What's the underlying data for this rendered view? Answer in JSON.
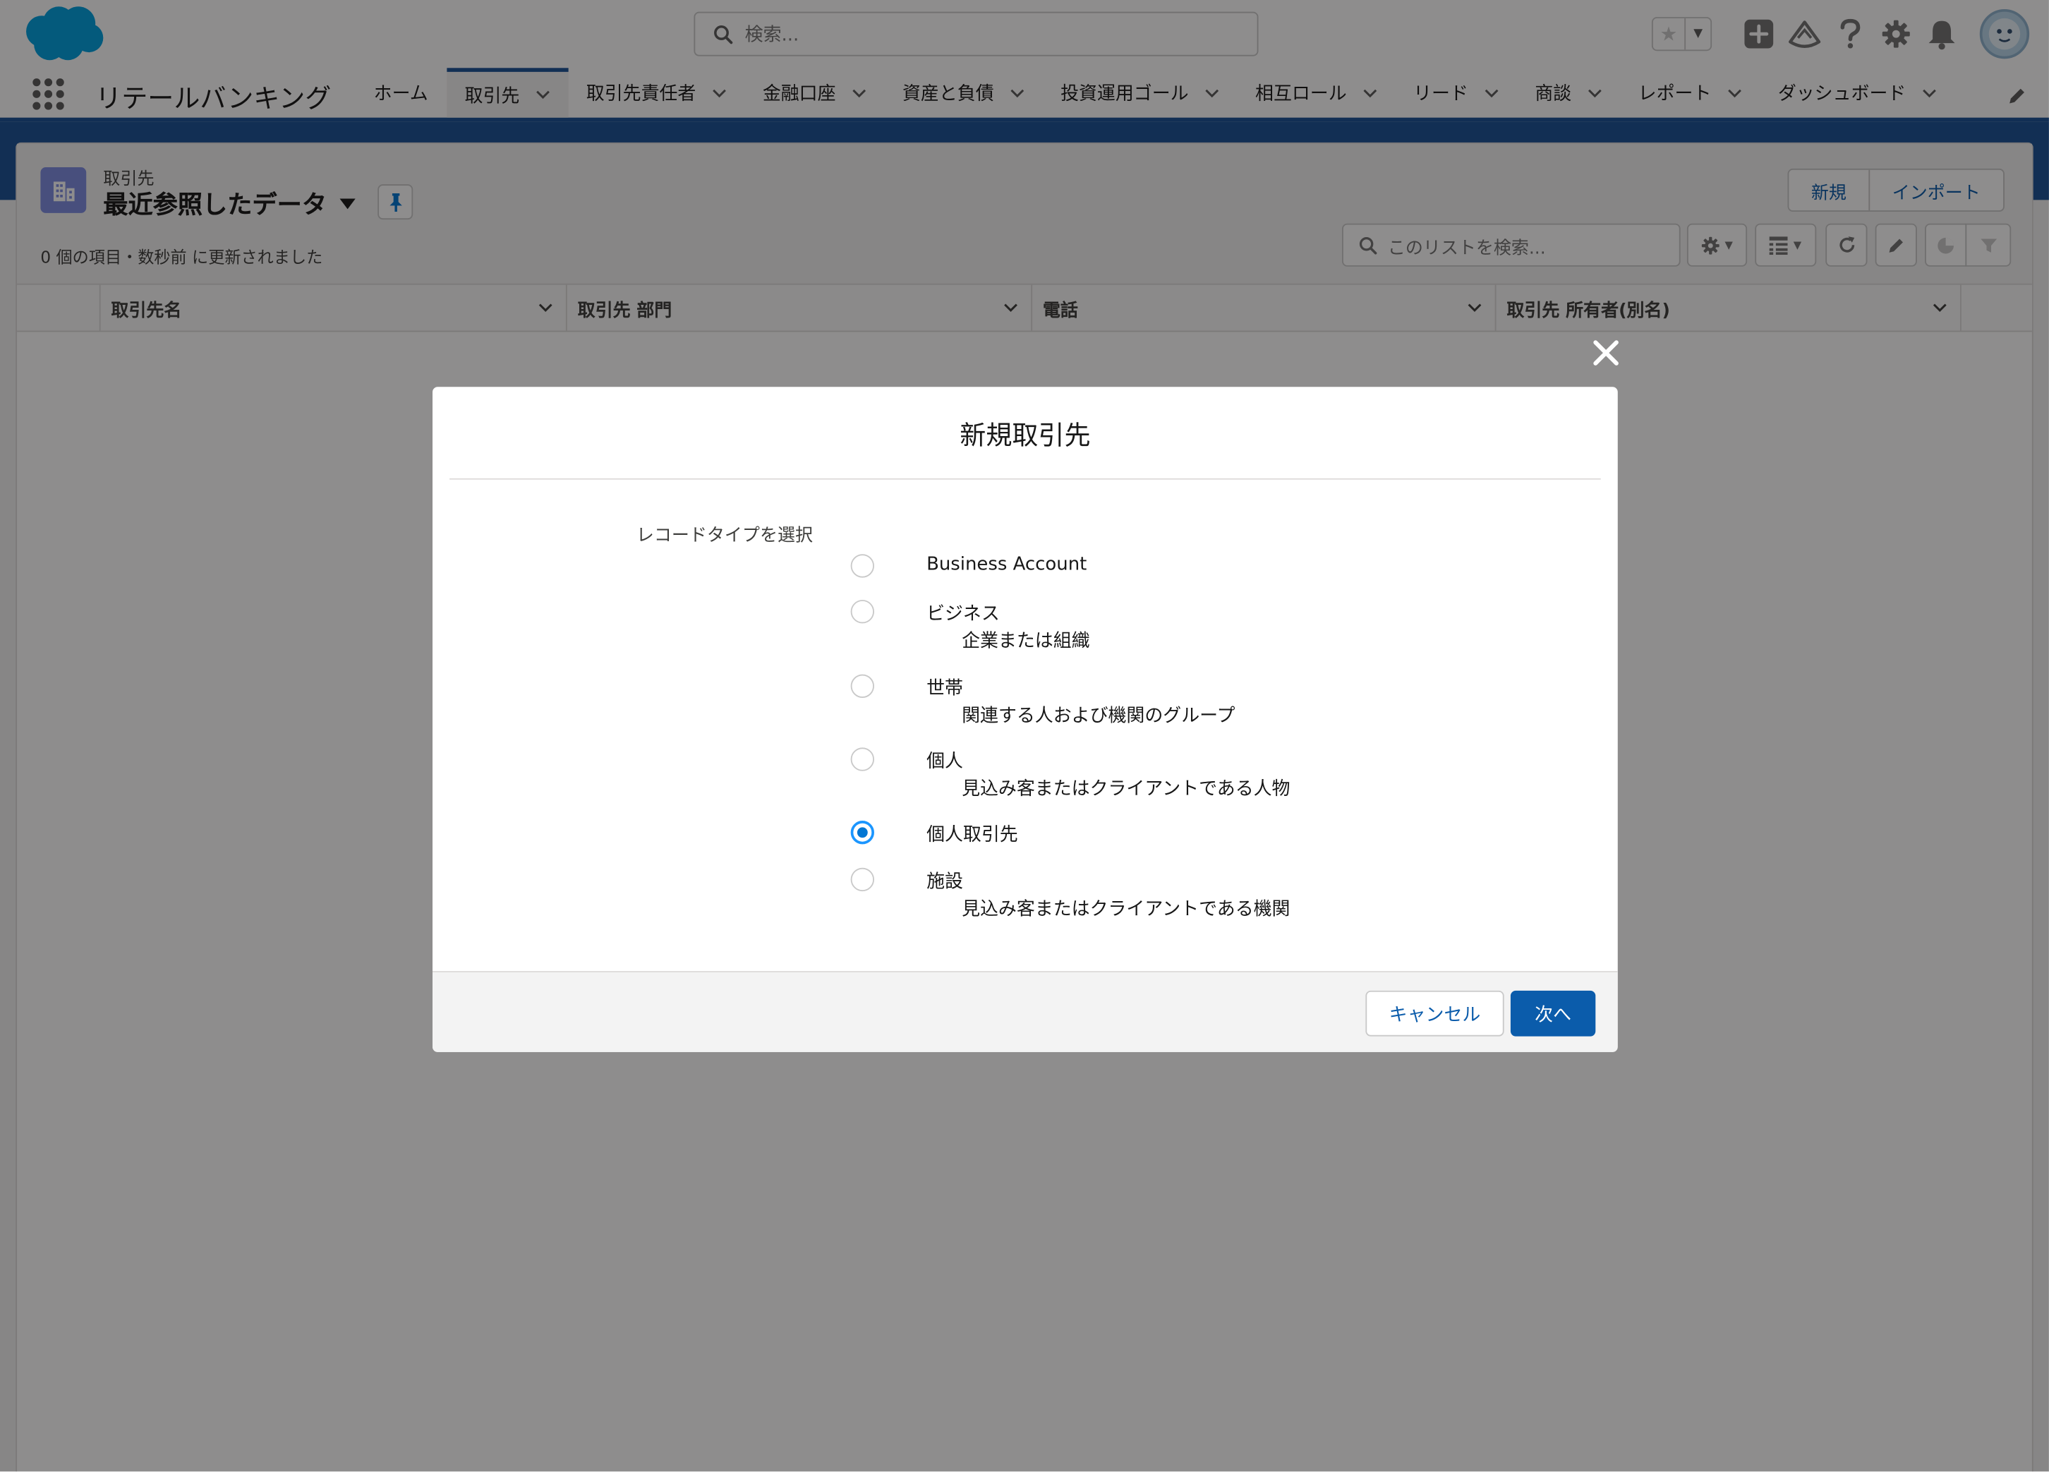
{
  "header": {
    "search_placeholder": "検索..."
  },
  "nav": {
    "app_name": "リテールバンキング",
    "tabs": [
      {
        "label": "ホーム",
        "has_menu": false
      },
      {
        "label": "取引先",
        "has_menu": true,
        "active": true
      },
      {
        "label": "取引先責任者",
        "has_menu": true
      },
      {
        "label": "金融口座",
        "has_menu": true
      },
      {
        "label": "資産と負債",
        "has_menu": true
      },
      {
        "label": "投資運用ゴール",
        "has_menu": true
      },
      {
        "label": "相互ロール",
        "has_menu": true
      },
      {
        "label": "リード",
        "has_menu": true
      },
      {
        "label": "商談",
        "has_menu": true
      },
      {
        "label": "レポート",
        "has_menu": true
      },
      {
        "label": "ダッシュボード",
        "has_menu": true
      }
    ]
  },
  "list_view": {
    "object_label": "取引先",
    "title": "最近参照したデータ",
    "meta": "0 個の項目・数秒前 に更新されました",
    "new_button": "新規",
    "import_button": "インポート",
    "search_placeholder": "このリストを検索...",
    "columns": [
      "取引先名",
      "取引先 部門",
      "電話",
      "取引先 所有者(別名)"
    ]
  },
  "modal": {
    "title": "新規取引先",
    "record_type_label": "レコードタイプを選択",
    "options": [
      {
        "label": "Business Account",
        "description": "",
        "selected": false
      },
      {
        "label": "ビジネス",
        "description": "企業または組織",
        "selected": false
      },
      {
        "label": "世帯",
        "description": "関連する人および機関のグループ",
        "selected": false
      },
      {
        "label": "個人",
        "description": "見込み客またはクライアントである人物",
        "selected": false
      },
      {
        "label": "個人取引先",
        "description": "",
        "selected": true
      },
      {
        "label": "施設",
        "description": "見込み客またはクライアントである機関",
        "selected": false
      }
    ],
    "cancel_button": "キャンセル",
    "next_button": "次へ"
  },
  "colors": {
    "brand": "#0176d3",
    "nav_accent": "#1b5297",
    "button_primary": "#0b5cab",
    "object_icon": "#7f8de1"
  }
}
